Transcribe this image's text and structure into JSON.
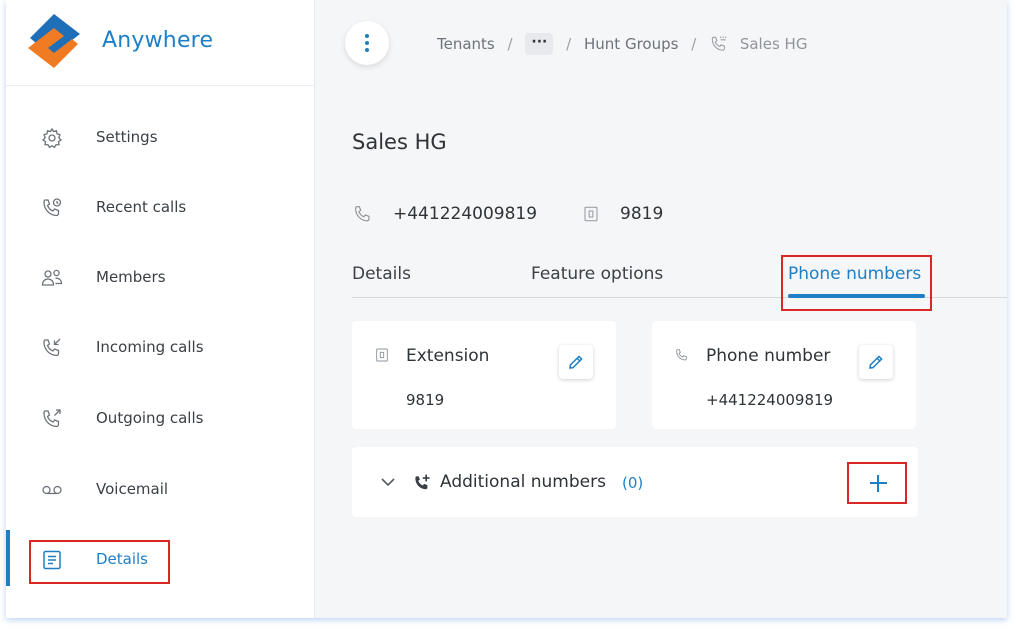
{
  "app": {
    "name": "Anywhere"
  },
  "sidebar": {
    "items": [
      {
        "label": "Settings",
        "icon": "gear-icon"
      },
      {
        "label": "Recent calls",
        "icon": "recent-calls-icon"
      },
      {
        "label": "Members",
        "icon": "members-icon"
      },
      {
        "label": "Incoming calls",
        "icon": "incoming-call-icon"
      },
      {
        "label": "Outgoing calls",
        "icon": "outgoing-call-icon"
      },
      {
        "label": "Voicemail",
        "icon": "voicemail-icon"
      },
      {
        "label": "Details",
        "icon": "details-icon",
        "active": true
      }
    ]
  },
  "breadcrumb": {
    "items": [
      "Tenants",
      "Hunt Groups"
    ],
    "ellipsis": "···",
    "separator": "/",
    "current": "Sales HG"
  },
  "page": {
    "title": "Sales HG",
    "phone": "+441224009819",
    "extension": "9819"
  },
  "tabs": [
    {
      "label": "Details"
    },
    {
      "label": "Feature options"
    },
    {
      "label": "Phone numbers",
      "active": true
    }
  ],
  "cards": {
    "extension": {
      "title": "Extension",
      "value": "9819"
    },
    "phone_number": {
      "title": "Phone number",
      "value": "+441224009819"
    },
    "additional": {
      "title": "Additional numbers",
      "count": "(0)"
    }
  },
  "colors": {
    "accent": "#1f7fc4",
    "highlight": "#d92626",
    "logo_orange": "#f07b22",
    "logo_blue": "#1f6fb8"
  }
}
